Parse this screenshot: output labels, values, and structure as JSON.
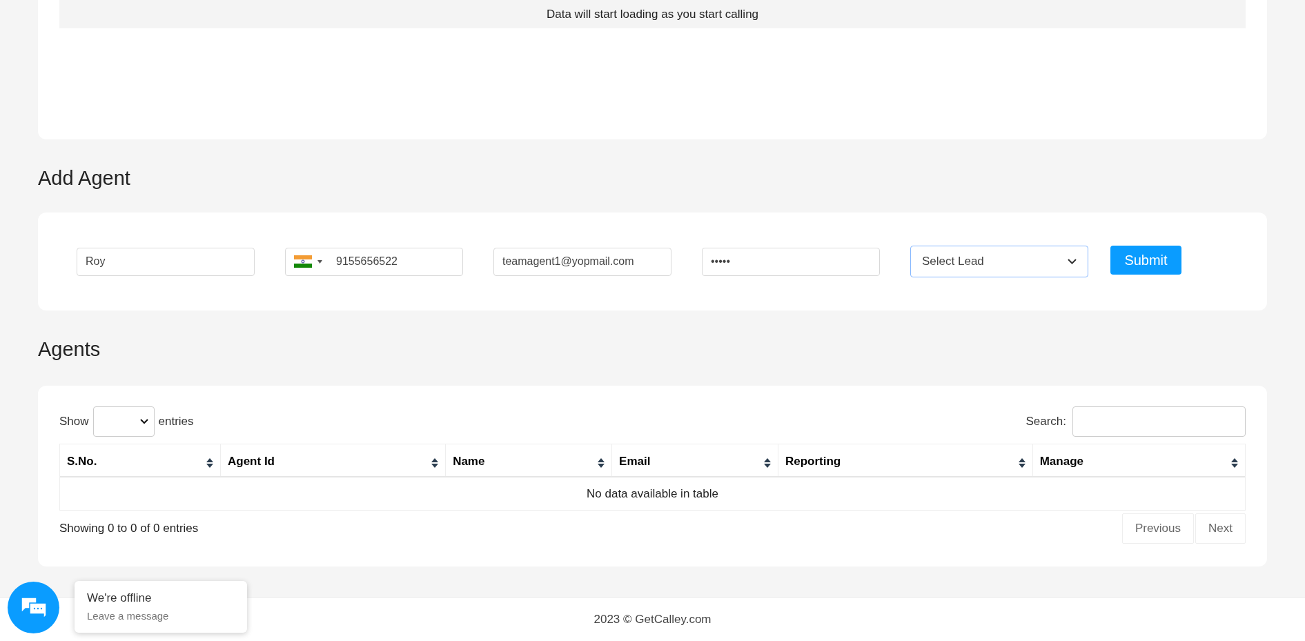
{
  "notice": "Data will start loading as you start calling",
  "add_agent": {
    "title": "Add Agent",
    "name": {
      "value": "Roy"
    },
    "phone": {
      "value": "9155656522"
    },
    "email": {
      "value": "teamagent1@yopmail.com"
    },
    "password": {
      "value": "•••••"
    },
    "lead_select": {
      "value": "Select Lead"
    },
    "submit": "Submit"
  },
  "agents": {
    "title": "Agents",
    "show_label": "Show",
    "entries_label": "entries",
    "search_label": "Search:",
    "columns": [
      "S.No.",
      "Agent Id",
      "Name",
      "Email",
      "Reporting",
      "Manage"
    ],
    "empty_message": "No data available in table",
    "info": "Showing 0 to 0 of 0 entries",
    "pagination": [
      {
        "label": "Previous",
        "disabled": true
      },
      {
        "label": "Next",
        "disabled": true
      }
    ]
  },
  "footer": "2023 © GetCalley.com",
  "chat": {
    "title": "We're offline",
    "subtitle": "Leave a message"
  }
}
